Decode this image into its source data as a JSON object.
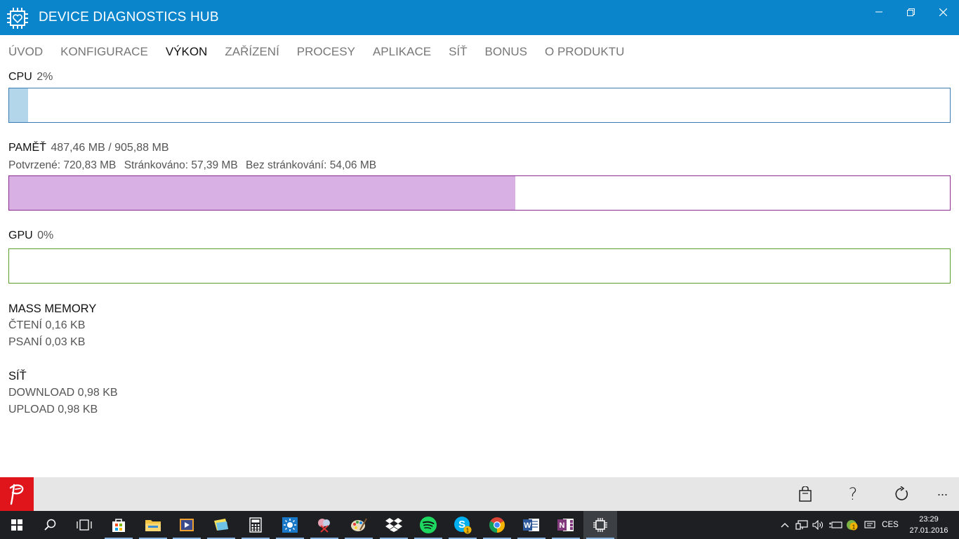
{
  "window": {
    "title": "DEVICE DIAGNOSTICS HUB"
  },
  "nav": {
    "items": [
      "ÚVOD",
      "KONFIGURACE",
      "VÝKON",
      "ZAŘÍZENÍ",
      "PROCESY",
      "APLIKACE",
      "SÍŤ",
      "BONUS",
      "O PRODUKTU"
    ],
    "active": "VÝKON"
  },
  "cpu": {
    "label": "CPU",
    "value": "2%",
    "fill_percent": 2,
    "color": "#b4d6ea",
    "border_color": "#3a7bb3"
  },
  "memory": {
    "label": "PAMĚŤ",
    "value": "487,46 MB / 905,88 MB",
    "committed": "Potvrzené: 720,83 MB",
    "paged": "Stránkováno: 57,39 MB",
    "nonpaged": "Bez stránkování: 54,06 MB",
    "fill_percent": 53.8,
    "color": "#d9b0e3",
    "border_color": "#8b2b92"
  },
  "gpu": {
    "label": "GPU",
    "value": "0%",
    "fill_percent": 0,
    "color": "#cfe8bd",
    "border_color": "#5a9f2e"
  },
  "mass_memory": {
    "title": "MASS MEMORY",
    "read": "ČTENÍ 0,16 KB",
    "write": "PSANÍ 0,03 KB"
  },
  "network": {
    "title": "SÍŤ",
    "download": "DOWNLOAD 0,98 KB",
    "upload": "UPLOAD 0,98 KB"
  },
  "appbar": {
    "buttons": [
      "store-icon",
      "help-icon",
      "refresh-icon",
      "more-icon"
    ],
    "help_glyph": "?",
    "more_glyph": "···"
  },
  "taskbar": {
    "apps": [
      "start-icon",
      "search-icon",
      "task-view-icon",
      "store-app-icon",
      "file-explorer-icon",
      "media-player-icon",
      "sticky-notes-icon",
      "calculator-icon",
      "weather-icon",
      "snipping-icon",
      "paint-icon",
      "dropbox-icon",
      "spotify-icon",
      "skype-icon",
      "chrome-icon",
      "word-icon",
      "onenote-icon",
      "diagnostics-app-icon"
    ],
    "skype_badge": "1",
    "tray_badge": "1",
    "language": "CES",
    "time": "23:29",
    "date": "27.01.2016"
  }
}
